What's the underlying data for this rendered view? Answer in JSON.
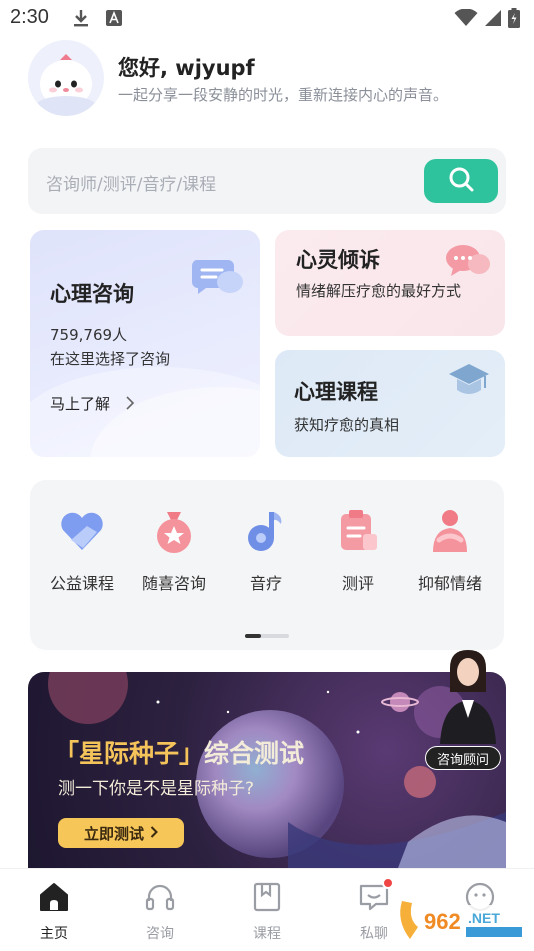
{
  "status_bar": {
    "time": "2:30"
  },
  "greeting": {
    "title": "您好, wjyupf",
    "subtitle": "一起分享一段安静的时光，重新连接内心的声音。"
  },
  "search": {
    "placeholder": "咨询师/测评/音疗/课程"
  },
  "cards": {
    "consult": {
      "title": "心理咨询",
      "count": "759,769人",
      "desc": "在这里选择了咨询",
      "link": "马上了解"
    },
    "confide": {
      "title": "心灵倾诉",
      "desc": "情绪解压疗愈的最好方式"
    },
    "course": {
      "title": "心理课程",
      "desc": "获知疗愈的真相"
    }
  },
  "categories": [
    {
      "label": "公益课程",
      "icon": "heart-hand-icon"
    },
    {
      "label": "随喜咨询",
      "icon": "star-bag-icon"
    },
    {
      "label": "音疗",
      "icon": "music-note-icon"
    },
    {
      "label": "测评",
      "icon": "clipboard-icon"
    },
    {
      "label": "抑郁情绪",
      "icon": "hug-person-icon"
    }
  ],
  "banner": {
    "title_prefix": "「星际种子」",
    "title_rest": "综合测试",
    "subtitle": "测一下你是不是星际种子?",
    "button": "立即测试",
    "advisor_tag": "咨询顾问"
  },
  "nav": [
    {
      "label": "主页",
      "icon": "home-icon",
      "active": true
    },
    {
      "label": "咨询",
      "icon": "headset-icon"
    },
    {
      "label": "课程",
      "icon": "book-icon"
    },
    {
      "label": "私聊",
      "icon": "chat-icon"
    },
    {
      "label": "",
      "icon": "smile-icon"
    }
  ],
  "colors": {
    "accent": "#2ec39c",
    "banner_button": "#f6c659",
    "badge": "#f04545"
  }
}
